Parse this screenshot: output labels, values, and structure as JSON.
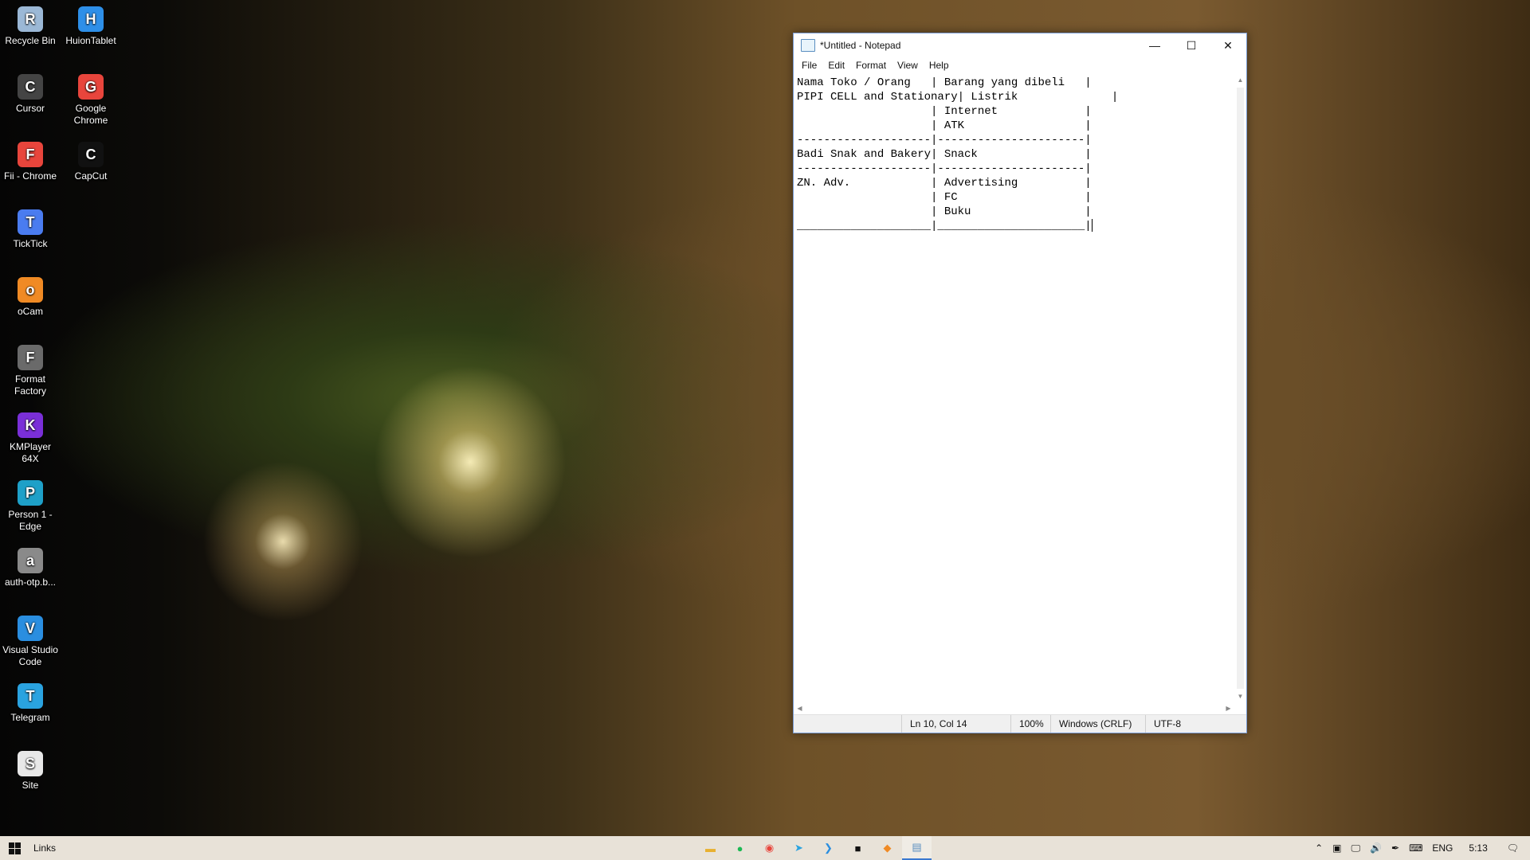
{
  "desktop": {
    "icons": [
      {
        "label": "Recycle Bin",
        "icon": "recycle-bin-icon",
        "color": "#9bb8d6"
      },
      {
        "label": "HuionTablet",
        "icon": "huion-tablet-icon",
        "color": "#2e8fe8"
      },
      {
        "label": "Cursor",
        "icon": "cursor-icon",
        "color": "#444444"
      },
      {
        "label": "Google Chrome",
        "icon": "chrome-icon",
        "color": "#e8453c"
      },
      {
        "label": "Fii - Chrome",
        "icon": "chrome-icon",
        "color": "#e8453c"
      },
      {
        "label": "CapCut",
        "icon": "capcut-icon",
        "color": "#111111"
      },
      {
        "label": "TickTick",
        "icon": "ticktick-icon",
        "color": "#4a7cf0"
      },
      {
        "label": "oCam",
        "icon": "ocam-icon",
        "color": "#f08a24"
      },
      {
        "label": "Format Factory",
        "icon": "format-factory-icon",
        "color": "#6a6a6a"
      },
      {
        "label": "KMPlayer 64X",
        "icon": "kmplayer-icon",
        "color": "#7a2fd8"
      },
      {
        "label": "Person 1 - Edge",
        "icon": "edge-icon",
        "color": "#1ea0c8"
      },
      {
        "label": "auth-otp.b...",
        "icon": "file-icon",
        "color": "#8a8a8a"
      },
      {
        "label": "Visual Studio Code",
        "icon": "vscode-icon",
        "color": "#2a8ee0"
      },
      {
        "label": "Telegram",
        "icon": "telegram-icon",
        "color": "#2aa3e0"
      },
      {
        "label": "Site",
        "icon": "document-icon",
        "color": "#e8e8e8"
      }
    ]
  },
  "notepad": {
    "title": "*Untitled - Notepad",
    "menu": [
      "File",
      "Edit",
      "Format",
      "View",
      "Help"
    ],
    "text": "Nama Toko / Orang   | Barang yang dibeli   |\nPIPI CELL and Stationary| Listrik              |\n                    | Internet             |\n                    | ATK                  |\n--------------------|----------------------|\nBadi Snak and Bakery| Snack                |\n--------------------|----------------------|\nZN. Adv.            | Advertising          |\n                    | FC                   |\n                    | Buku                 |\n____________________|______________________|",
    "status": {
      "position": "Ln 10, Col 14",
      "zoom": "100%",
      "line_ending": "Windows (CRLF)",
      "encoding": "UTF-8"
    }
  },
  "taskbar": {
    "links_label": "Links",
    "apps": [
      {
        "icon": "file-explorer-icon",
        "glyph": "▬",
        "color": "#e8b030"
      },
      {
        "icon": "spotify-icon",
        "glyph": "●",
        "color": "#1db954"
      },
      {
        "icon": "chrome-icon",
        "glyph": "◉",
        "color": "#e8453c"
      },
      {
        "icon": "telegram-icon",
        "glyph": "➤",
        "color": "#2aa3e0"
      },
      {
        "icon": "vscode-icon",
        "glyph": "❯",
        "color": "#2a8ee0"
      },
      {
        "icon": "capcut-icon",
        "glyph": "■",
        "color": "#111111"
      },
      {
        "icon": "sublime-icon",
        "glyph": "◆",
        "color": "#f08a24"
      },
      {
        "icon": "notepad-icon",
        "glyph": "▤",
        "color": "#5a8ec0"
      }
    ],
    "tray": {
      "language": "ENG",
      "time": "5:13"
    }
  }
}
